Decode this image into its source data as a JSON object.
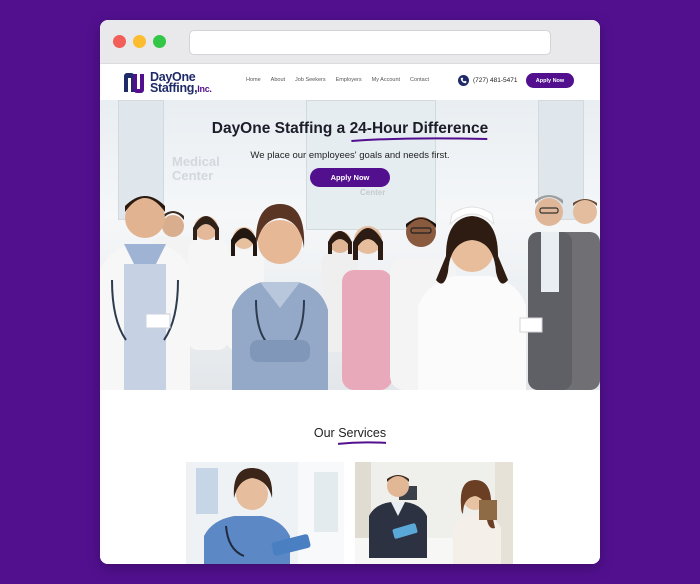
{
  "brand": {
    "name_line1": "DayOne",
    "name_line2": "Staffing,",
    "suffix": "Inc."
  },
  "nav": {
    "links": [
      "Home",
      "About",
      "Job Seekers",
      "Employers",
      "My Account",
      "Contact"
    ],
    "phone": "(727) 481-5471",
    "apply_label": "Apply Now"
  },
  "hero": {
    "title_prefix": "DayOne Staffing a ",
    "title_highlight": "24-Hour Difference",
    "subtitle": "We place our employees' goals and needs first.",
    "apply_label": "Apply Now",
    "bg_sign_1": "Medical",
    "bg_sign_2": "Center",
    "bg_sign_3": "Center"
  },
  "services": {
    "title_prefix": "Our ",
    "title_highlight": "Services"
  },
  "colors": {
    "background": "#52108f",
    "accent": "#52108f",
    "brand_navy": "#1f2a68"
  },
  "icons": {
    "phone": "phone-icon",
    "logo": "dayone-logo-mark"
  }
}
